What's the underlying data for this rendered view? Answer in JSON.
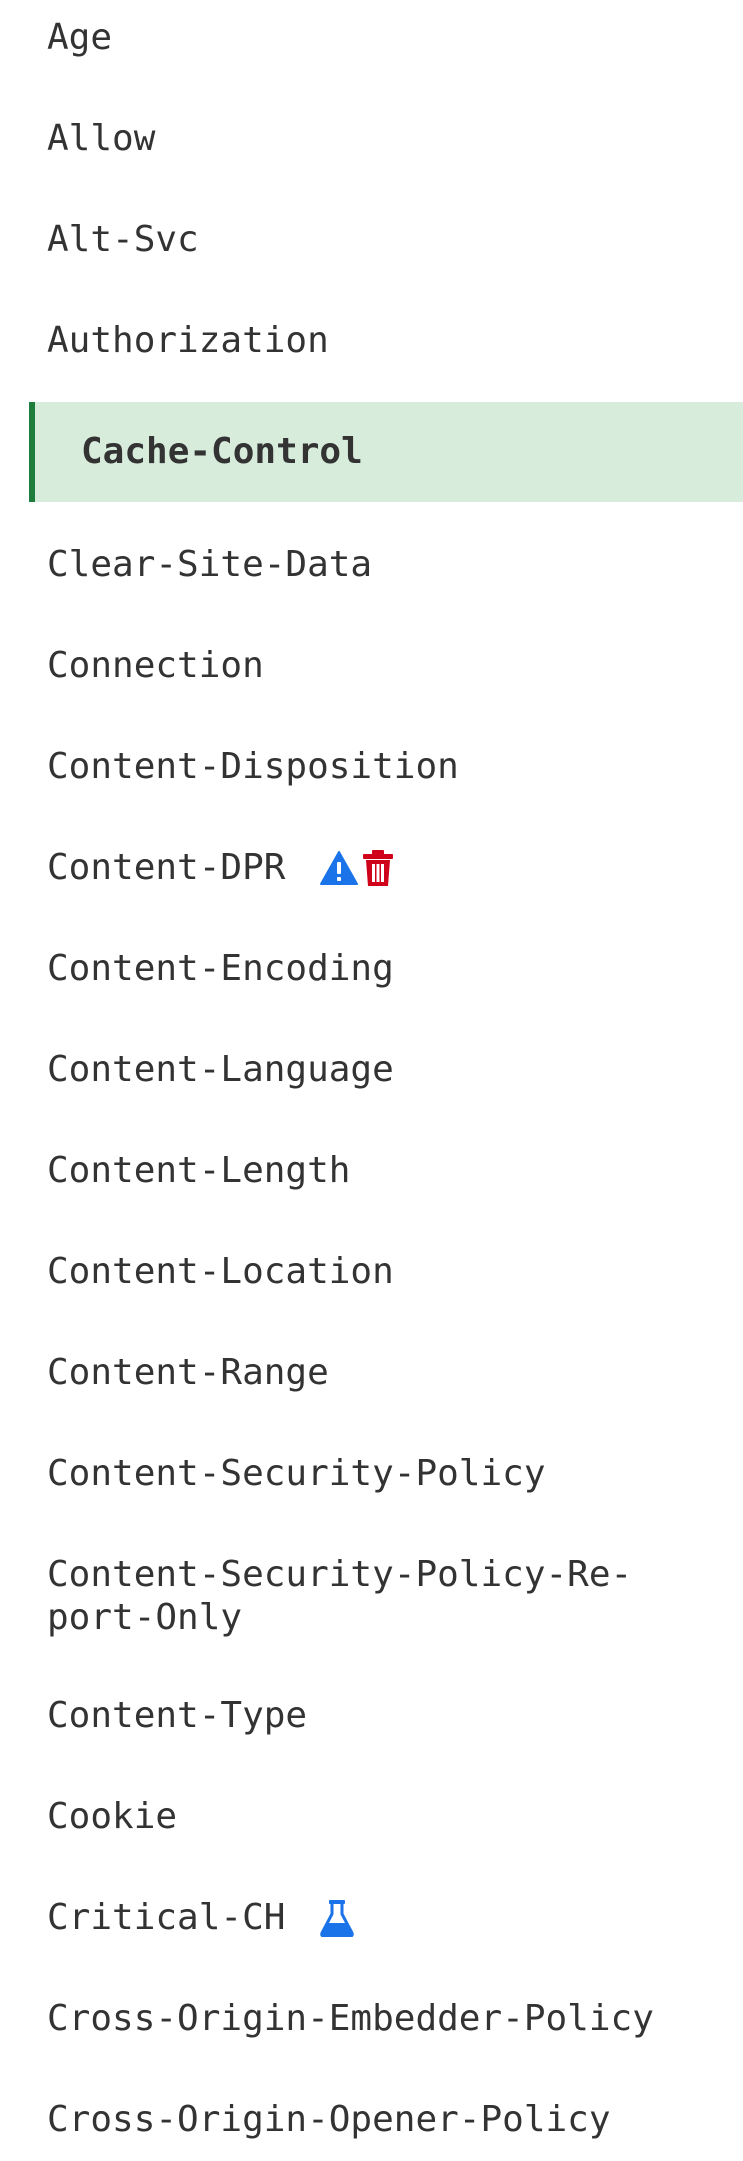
{
  "sidebar": {
    "items": [
      {
        "label": "Age"
      },
      {
        "label": "Allow"
      },
      {
        "label": "Alt-Svc"
      },
      {
        "label": "Authorization"
      },
      {
        "label": "Cache-Control",
        "active": true
      },
      {
        "label": "Clear-Site-Data"
      },
      {
        "label": "Connection"
      },
      {
        "label": "Content-Disposition"
      },
      {
        "label": "Content-DPR",
        "icons": [
          "warning-icon",
          "trash-icon"
        ]
      },
      {
        "label": "Content-Encoding"
      },
      {
        "label": "Content-Language"
      },
      {
        "label": "Content-Length"
      },
      {
        "label": "Content-Location"
      },
      {
        "label": "Content-Range"
      },
      {
        "label": "Content-Security-Policy"
      },
      {
        "label": "Content-Security-Policy-Re-port-Only"
      },
      {
        "label": "Content-Type"
      },
      {
        "label": "Cookie"
      },
      {
        "label": "Critical-CH",
        "icons": [
          "flask-icon"
        ]
      },
      {
        "label": "Cross-Origin-Embedder-Policy"
      },
      {
        "label": "Cross-Origin-Opener-Policy"
      }
    ]
  },
  "colors": {
    "active_background": "#d7ecdb",
    "active_border": "#1e7d3b",
    "text": "#333333",
    "warning_icon": "#1a73e8",
    "trash_icon": "#d0021b",
    "flask_icon": "#1a73e8"
  }
}
